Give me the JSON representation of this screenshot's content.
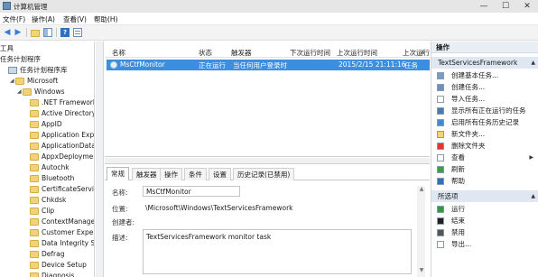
{
  "window": {
    "title": "计算机管理",
    "minimize": "—",
    "maximize": "☐",
    "close": "✕"
  },
  "menu": [
    {
      "label": "文件(F)"
    },
    {
      "label": "操作(A)"
    },
    {
      "label": "查看(V)"
    },
    {
      "label": "帮助(H)"
    }
  ],
  "tree": {
    "items": [
      {
        "label": "工具",
        "indent": 0,
        "icon": "none"
      },
      {
        "label": "任务计划程序",
        "indent": 0,
        "icon": "none"
      },
      {
        "label": "任务计划程序库",
        "indent": 1,
        "icon": "scheduler-library-icon"
      },
      {
        "label": "Microsoft",
        "indent": 2,
        "icon": "folder-icon",
        "expander": "◢"
      },
      {
        "label": "Windows",
        "indent": 3,
        "icon": "folder-icon",
        "expander": "◢"
      },
      {
        "label": ".NET Framework",
        "indent": 4,
        "icon": "folder-icon"
      },
      {
        "label": "Active Directory",
        "indent": 4,
        "icon": "folder-icon"
      },
      {
        "label": "AppID",
        "indent": 4,
        "icon": "folder-icon"
      },
      {
        "label": "Application Expe",
        "indent": 4,
        "icon": "folder-icon"
      },
      {
        "label": "ApplicationData",
        "indent": 4,
        "icon": "folder-icon"
      },
      {
        "label": "AppxDeploymen",
        "indent": 4,
        "icon": "folder-icon"
      },
      {
        "label": "Autochk",
        "indent": 4,
        "icon": "folder-icon"
      },
      {
        "label": "Bluetooth",
        "indent": 4,
        "icon": "folder-icon"
      },
      {
        "label": "CertificateServic",
        "indent": 4,
        "icon": "folder-icon"
      },
      {
        "label": "Chkdsk",
        "indent": 4,
        "icon": "folder-icon"
      },
      {
        "label": "Clip",
        "indent": 4,
        "icon": "folder-icon"
      },
      {
        "label": "ContextManager",
        "indent": 4,
        "icon": "folder-icon"
      },
      {
        "label": "Customer Experi",
        "indent": 4,
        "icon": "folder-icon"
      },
      {
        "label": "Data Integrity Sc",
        "indent": 4,
        "icon": "folder-icon"
      },
      {
        "label": "Defrag",
        "indent": 4,
        "icon": "folder-icon"
      },
      {
        "label": "Device Setup",
        "indent": 4,
        "icon": "folder-icon"
      },
      {
        "label": "Diagnosis",
        "indent": 4,
        "icon": "folder-icon"
      }
    ]
  },
  "task_list": {
    "columns": [
      {
        "label": "名称"
      },
      {
        "label": "状态"
      },
      {
        "label": "触发器"
      },
      {
        "label": "下次运行时间"
      },
      {
        "label": "上次运行时间"
      },
      {
        "label": "上次运行"
      }
    ],
    "rows": [
      {
        "name": "MsCtfMonitor",
        "status": "正在运行",
        "trigger": "当任何用户登录时",
        "next_run": "",
        "last_run": "2015/2/15 21:11:16",
        "last_result": "任务"
      }
    ]
  },
  "tabs": [
    {
      "label": "常规",
      "active": true
    },
    {
      "label": "触发器",
      "active": false
    },
    {
      "label": "操作",
      "active": false
    },
    {
      "label": "条件",
      "active": false
    },
    {
      "label": "设置",
      "active": false
    },
    {
      "label": "历史记录(已禁用)",
      "active": false
    }
  ],
  "details": {
    "name_label": "名称:",
    "name_value": "MsCtfMonitor",
    "location_label": "位置:",
    "location_value": "\\Microsoft\\Windows\\TextServicesFramework",
    "author_label": "创建者:",
    "author_value": "",
    "description_label": "描述:",
    "description_value": "TextServicesFramework monitor task"
  },
  "actions": {
    "header": "操作",
    "section1_title": "TextServicesFramework",
    "section1_items": [
      {
        "label": "创建基本任务...",
        "icon": "create-basic-task-icon",
        "color": "#7a9cc4"
      },
      {
        "label": "创建任务...",
        "icon": "create-task-icon",
        "color": "#6f8fb8"
      },
      {
        "label": "导入任务...",
        "icon": "import-task-icon",
        "color": "#ffffff"
      },
      {
        "label": "显示所有正在运行的任务",
        "icon": "running-tasks-icon",
        "color": "#4a7ab0"
      },
      {
        "label": "启用所有任务历史记录",
        "icon": "history-icon",
        "color": "#3d8ad6"
      },
      {
        "label": "新文件夹...",
        "icon": "new-folder-icon",
        "color": "#f3d27a"
      },
      {
        "label": "删除文件夹",
        "icon": "delete-folder-icon",
        "color": "#d93a2b"
      },
      {
        "label": "查看",
        "icon": "view-icon",
        "color": "#ffffff",
        "submenu": true
      },
      {
        "label": "刷新",
        "icon": "refresh-icon",
        "color": "#3aa04a"
      },
      {
        "label": "帮助",
        "icon": "help-icon",
        "color": "#2f6fc0"
      }
    ],
    "section2_title": "所选项",
    "section2_items": [
      {
        "label": "运行",
        "icon": "run-icon",
        "color": "#2e9b3c"
      },
      {
        "label": "结束",
        "icon": "end-icon",
        "color": "#222222"
      },
      {
        "label": "禁用",
        "icon": "disable-icon",
        "color": "#555555"
      },
      {
        "label": "导出...",
        "icon": "export-icon",
        "color": "#ffffff"
      }
    ]
  }
}
